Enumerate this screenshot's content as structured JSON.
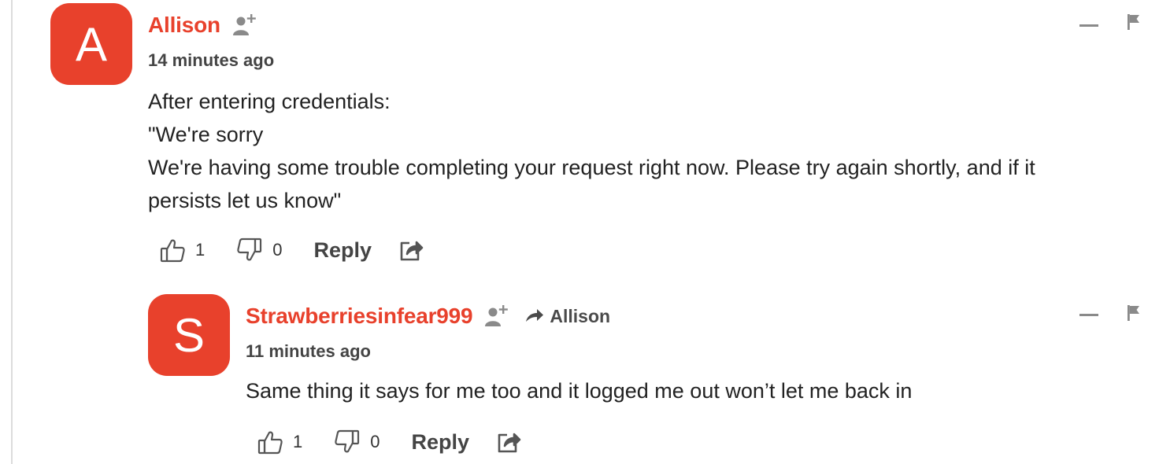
{
  "comments": [
    {
      "avatar_letter": "A",
      "author": "Allison",
      "timestamp": "14 minutes ago",
      "body": [
        "After entering credentials:",
        "\"We're sorry",
        "We're having some trouble completing your request right now. Please try again shortly, and if it",
        "persists let us know\""
      ],
      "likes": "1",
      "dislikes": "0",
      "reply_label": "Reply",
      "icons": [
        "follow-user-icon",
        "thumbs-up-icon",
        "thumbs-down-icon",
        "share-icon",
        "collapse-icon",
        "flag-icon"
      ]
    },
    {
      "avatar_letter": "S",
      "author": "Strawberriesinfear999",
      "reply_to": "Allison",
      "timestamp": "11 minutes ago",
      "body": [
        "Same thing it says for me too and it logged me out won’t let me back in"
      ],
      "likes": "1",
      "dislikes": "0",
      "reply_label": "Reply",
      "icons": [
        "follow-user-icon",
        "reply-arrow-icon",
        "thumbs-up-icon",
        "thumbs-down-icon",
        "share-icon",
        "collapse-icon",
        "flag-icon"
      ]
    }
  ],
  "colors": {
    "accent": "#e8412c",
    "icon_gray": "#8a8a8a",
    "text": "#222222",
    "rule": "#dcdcdc"
  }
}
